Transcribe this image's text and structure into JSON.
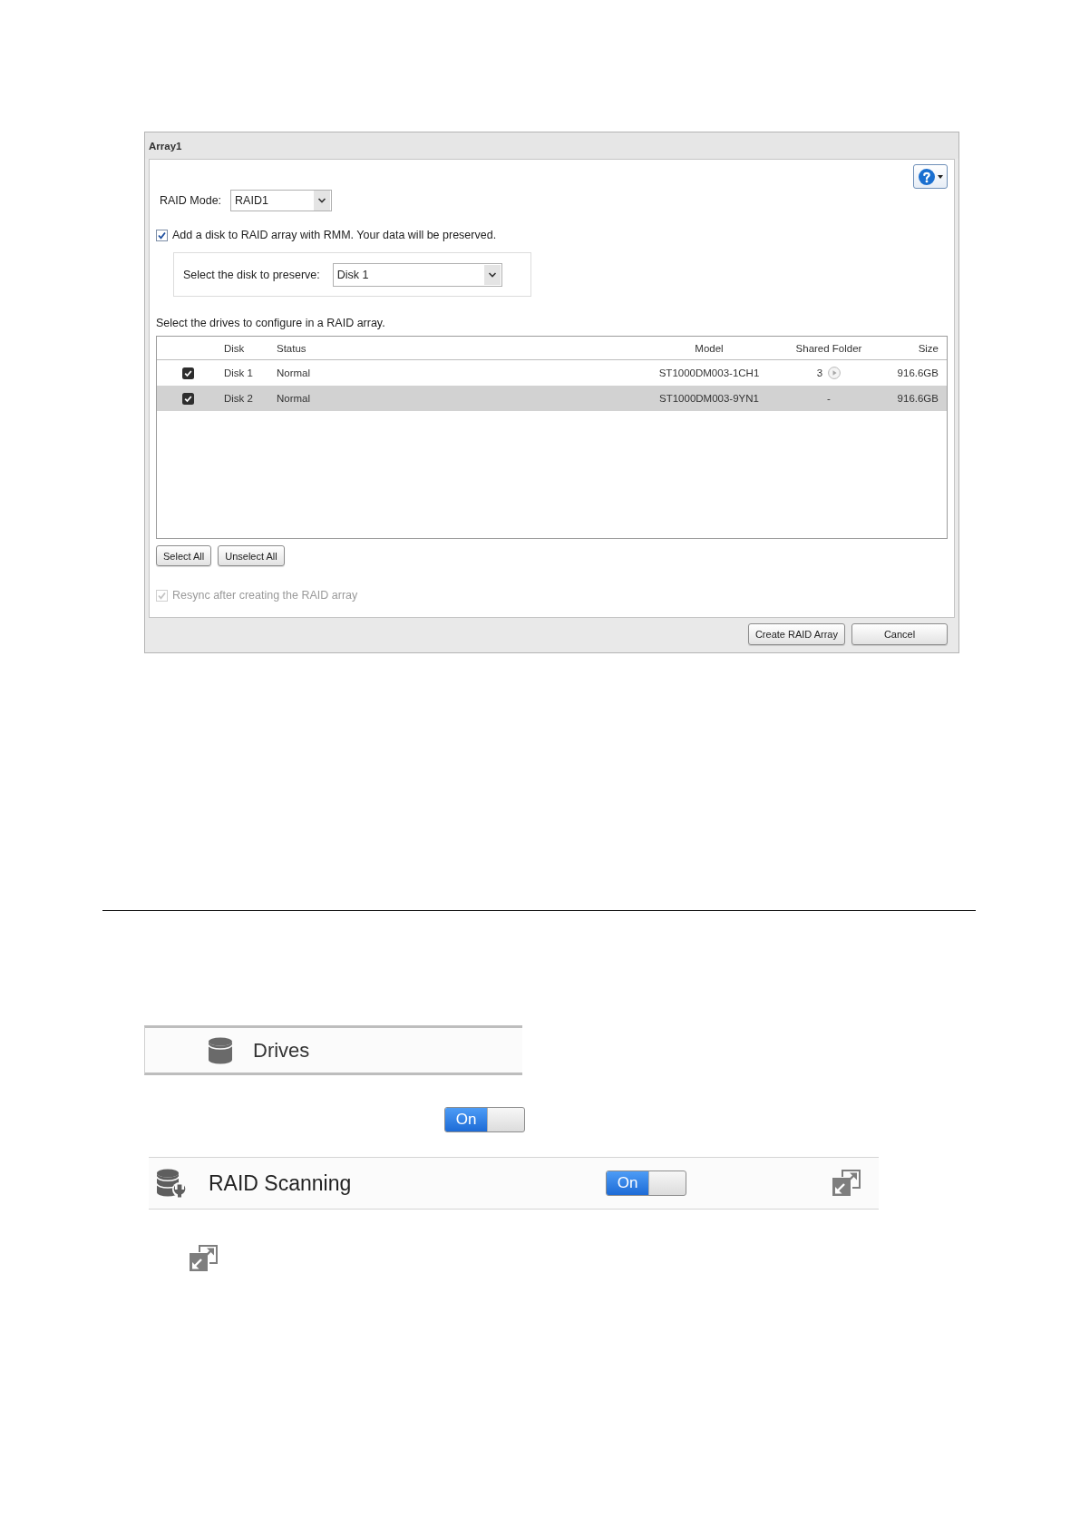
{
  "dialog": {
    "title": "Array1",
    "raid_mode": {
      "label": "RAID Mode:",
      "value": "RAID1"
    },
    "rmm_option": {
      "label": "Add a disk to RAID array with RMM. Your data will be preserved.",
      "checked": true
    },
    "preserve_disk": {
      "label": "Select the disk to preserve:",
      "value": "Disk 1"
    },
    "table_caption": "Select the drives to configure in a RAID array.",
    "table": {
      "columns": [
        "Disk",
        "Status",
        "Model",
        "Shared Folder",
        "Size"
      ],
      "rows": [
        {
          "checked": true,
          "selected": false,
          "disk": "Disk 1",
          "status": "Normal",
          "model": "ST1000DM003-1CH1",
          "shared_folder": "3",
          "folder_link": true,
          "size": "916.6GB"
        },
        {
          "checked": true,
          "selected": true,
          "disk": "Disk 2",
          "status": "Normal",
          "model": "ST1000DM003-9YN1",
          "shared_folder": "-",
          "folder_link": false,
          "size": "916.6GB"
        }
      ]
    },
    "select_buttons": [
      "Select All",
      "Unselect All"
    ],
    "resync_option": {
      "label": "Resync after creating the RAID array",
      "checked": true,
      "disabled": true
    },
    "footer_buttons": [
      "Create RAID Array",
      "Cancel"
    ]
  },
  "drives_item": {
    "label": "Drives"
  },
  "toggle": {
    "label": "On",
    "on": true
  },
  "raid_scanning": {
    "label": "RAID Scanning",
    "toggle": {
      "label": "On",
      "on": true
    }
  }
}
